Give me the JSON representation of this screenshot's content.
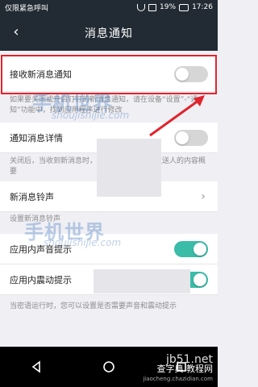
{
  "status_bar": {
    "left_text": "仅限紧急呼叫",
    "battery": "19%",
    "time": "17:26"
  },
  "nav": {
    "title": "消息通知",
    "back_icon": "chevron-left-icon"
  },
  "settings": {
    "receive_new": {
      "label": "接收新消息通知",
      "on": false
    },
    "receive_note": "如果要关闭或开启钉钉的新消息通知，请在设备“设置”-“通知”功能中，找到应用程序进行修改",
    "detail": {
      "label": "通知消息详情",
      "on": false
    },
    "detail_note": "关闭后，当收到新消息时，通知提示将不显示发送人的内容概要",
    "ringtone": {
      "label": "新消息铃声"
    },
    "ringtone_note": "设置新消息铃声",
    "in_app_sound": {
      "label": "应用内声音提示",
      "on": true
    },
    "in_app_vibrate": {
      "label": "应用内震动提示",
      "on": true
    },
    "bottom_note": "当密语运行时，您可以设置是否需要声音和震动提示"
  },
  "watermarks": {
    "main": "手机世界",
    "sub": "shoujishijie.com"
  },
  "footer": {
    "brand": "jb51.net",
    "line2": "查字典 教程网",
    "line3": "jiaocheng.chazidian.com"
  },
  "colors": {
    "header_bg": "#222b33",
    "highlight": "#e1232c",
    "toggle_on": "#3bbca8",
    "toggle_off": "#d6d6d6"
  }
}
